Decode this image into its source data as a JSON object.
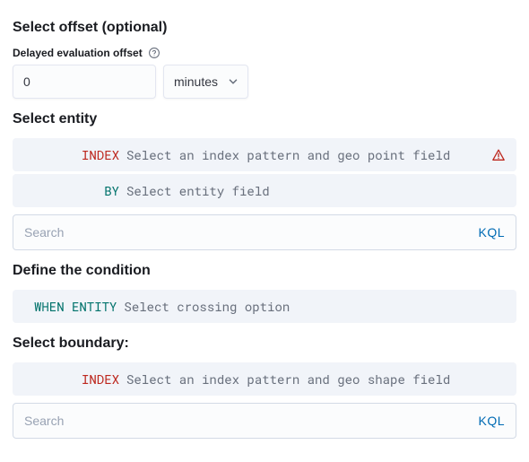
{
  "offset": {
    "title": "Select offset (optional)",
    "label": "Delayed evaluation offset",
    "value": "0",
    "unit": "minutes"
  },
  "entity": {
    "title": "Select entity",
    "index_keyword": "INDEX",
    "index_placeholder": "Select an index pattern and geo point field",
    "by_keyword": "BY",
    "by_placeholder": "Select entity field",
    "search_placeholder": "Search",
    "kql": "KQL"
  },
  "condition": {
    "title": "Define the condition",
    "when_keyword": "WHEN ENTITY",
    "when_placeholder": "Select crossing option"
  },
  "boundary": {
    "title": "Select boundary:",
    "index_keyword": "INDEX",
    "index_placeholder": "Select an index pattern and geo shape field",
    "search_placeholder": "Search",
    "kql": "KQL"
  }
}
